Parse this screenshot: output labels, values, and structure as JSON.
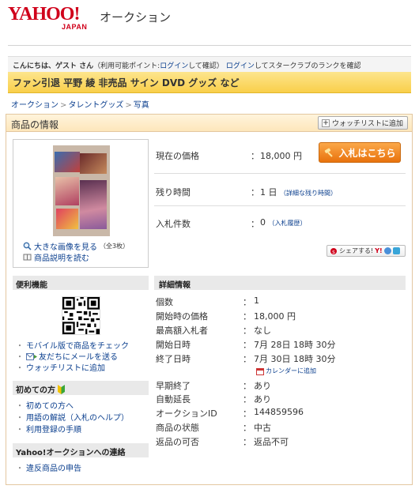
{
  "header": {
    "logo_main": "YAHOO!",
    "logo_sub": "JAPAN",
    "service": "オークション"
  },
  "greeting": {
    "text": "こんにちは、ゲスト さん",
    "points_prefix": "（利用可能ポイント:",
    "login_link": "ログイン",
    "points_suffix": "して確認）",
    "login_link2": "ログイン",
    "rank_text": "してスタークラブのランクを確認"
  },
  "title": "ファン引退 平野 綾 非売品 サイン DVD グッズ など",
  "breadcrumb": [
    "オークション",
    "タレントグッズ",
    "写真"
  ],
  "panel": {
    "title": "商品の情報",
    "watchlist_button": "ウォッチリストに追加"
  },
  "image_box": {
    "large_image_link": "大きな画像を見る",
    "large_image_note": "（全3枚）",
    "description_link": "商品説明を読む"
  },
  "price": {
    "current_label": "現在の価格",
    "current_value": "18,000 円",
    "bid_button": "入札はこちら",
    "remaining_label": "残り時間",
    "remaining_value": "1 日",
    "remaining_link": "（詳細な残り時間）",
    "bids_label": "入札件数",
    "bids_value": "0",
    "bids_link": "（入札履歴）",
    "colon": "："
  },
  "share_button": "シェアする!",
  "share_brand": "Y!",
  "convenience": {
    "title": "便利機能",
    "links": [
      "モバイル版で商品をチェック",
      "友だちにメールを送る",
      "ウォッチリストに追加"
    ]
  },
  "beginner": {
    "title": "初めての方",
    "links": [
      "初めての方へ",
      "用語の解説（入札のヘルプ）",
      "利用登録の手順"
    ]
  },
  "contact": {
    "title": "Yahoo!オークションへの連絡",
    "links": [
      "違反商品の申告"
    ]
  },
  "detail": {
    "title": "詳細情報",
    "rows": [
      {
        "label": "個数",
        "value": "1"
      },
      {
        "label": "開始時の価格",
        "value": "18,000 円"
      },
      {
        "label": "最高額入札者",
        "value": "なし"
      },
      {
        "label": "開始日時",
        "value": "7月 28日 18時 30分"
      },
      {
        "label": "終了日時",
        "value": "7月 30日 18時 30分"
      },
      {
        "label": "早期終了",
        "value": "あり"
      },
      {
        "label": "自動延長",
        "value": "あり"
      },
      {
        "label": "オークションID",
        "value": "144859596"
      },
      {
        "label": "商品の状態",
        "value": "中古"
      },
      {
        "label": "返品の可否",
        "value": "返品不可"
      }
    ],
    "calendar_link": "カレンダーに追加"
  }
}
